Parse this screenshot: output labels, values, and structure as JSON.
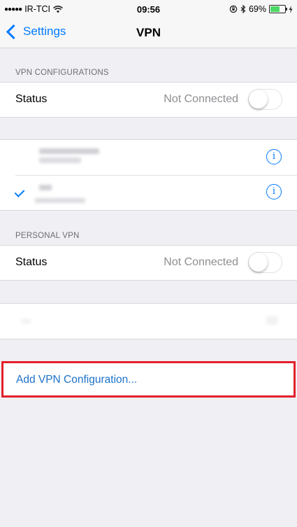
{
  "status_bar": {
    "signal_dots": "●●●●●",
    "carrier": "IR-TCI",
    "time": "09:56",
    "battery_percent": "69%",
    "battery_level": 0.69,
    "icons": [
      "wifi-icon",
      "rotation-lock-icon",
      "bluetooth-icon",
      "battery-icon",
      "charging-icon"
    ]
  },
  "nav": {
    "back_label": "Settings",
    "title": "VPN"
  },
  "vpn_configurations": {
    "header": "VPN CONFIGURATIONS",
    "status_label": "Status",
    "status_value": "Not Connected",
    "toggle_on": false
  },
  "personal_vpn": {
    "header": "PERSONAL VPN",
    "status_label": "Status",
    "status_value": "Not Connected",
    "toggle_on": false
  },
  "info_symbol": "i",
  "add_config_label": "Add VPN Configuration...",
  "colors": {
    "accent": "#007aff",
    "highlight_border": "#e2202b",
    "link": "#1d72c8",
    "background": "#efeff4"
  }
}
